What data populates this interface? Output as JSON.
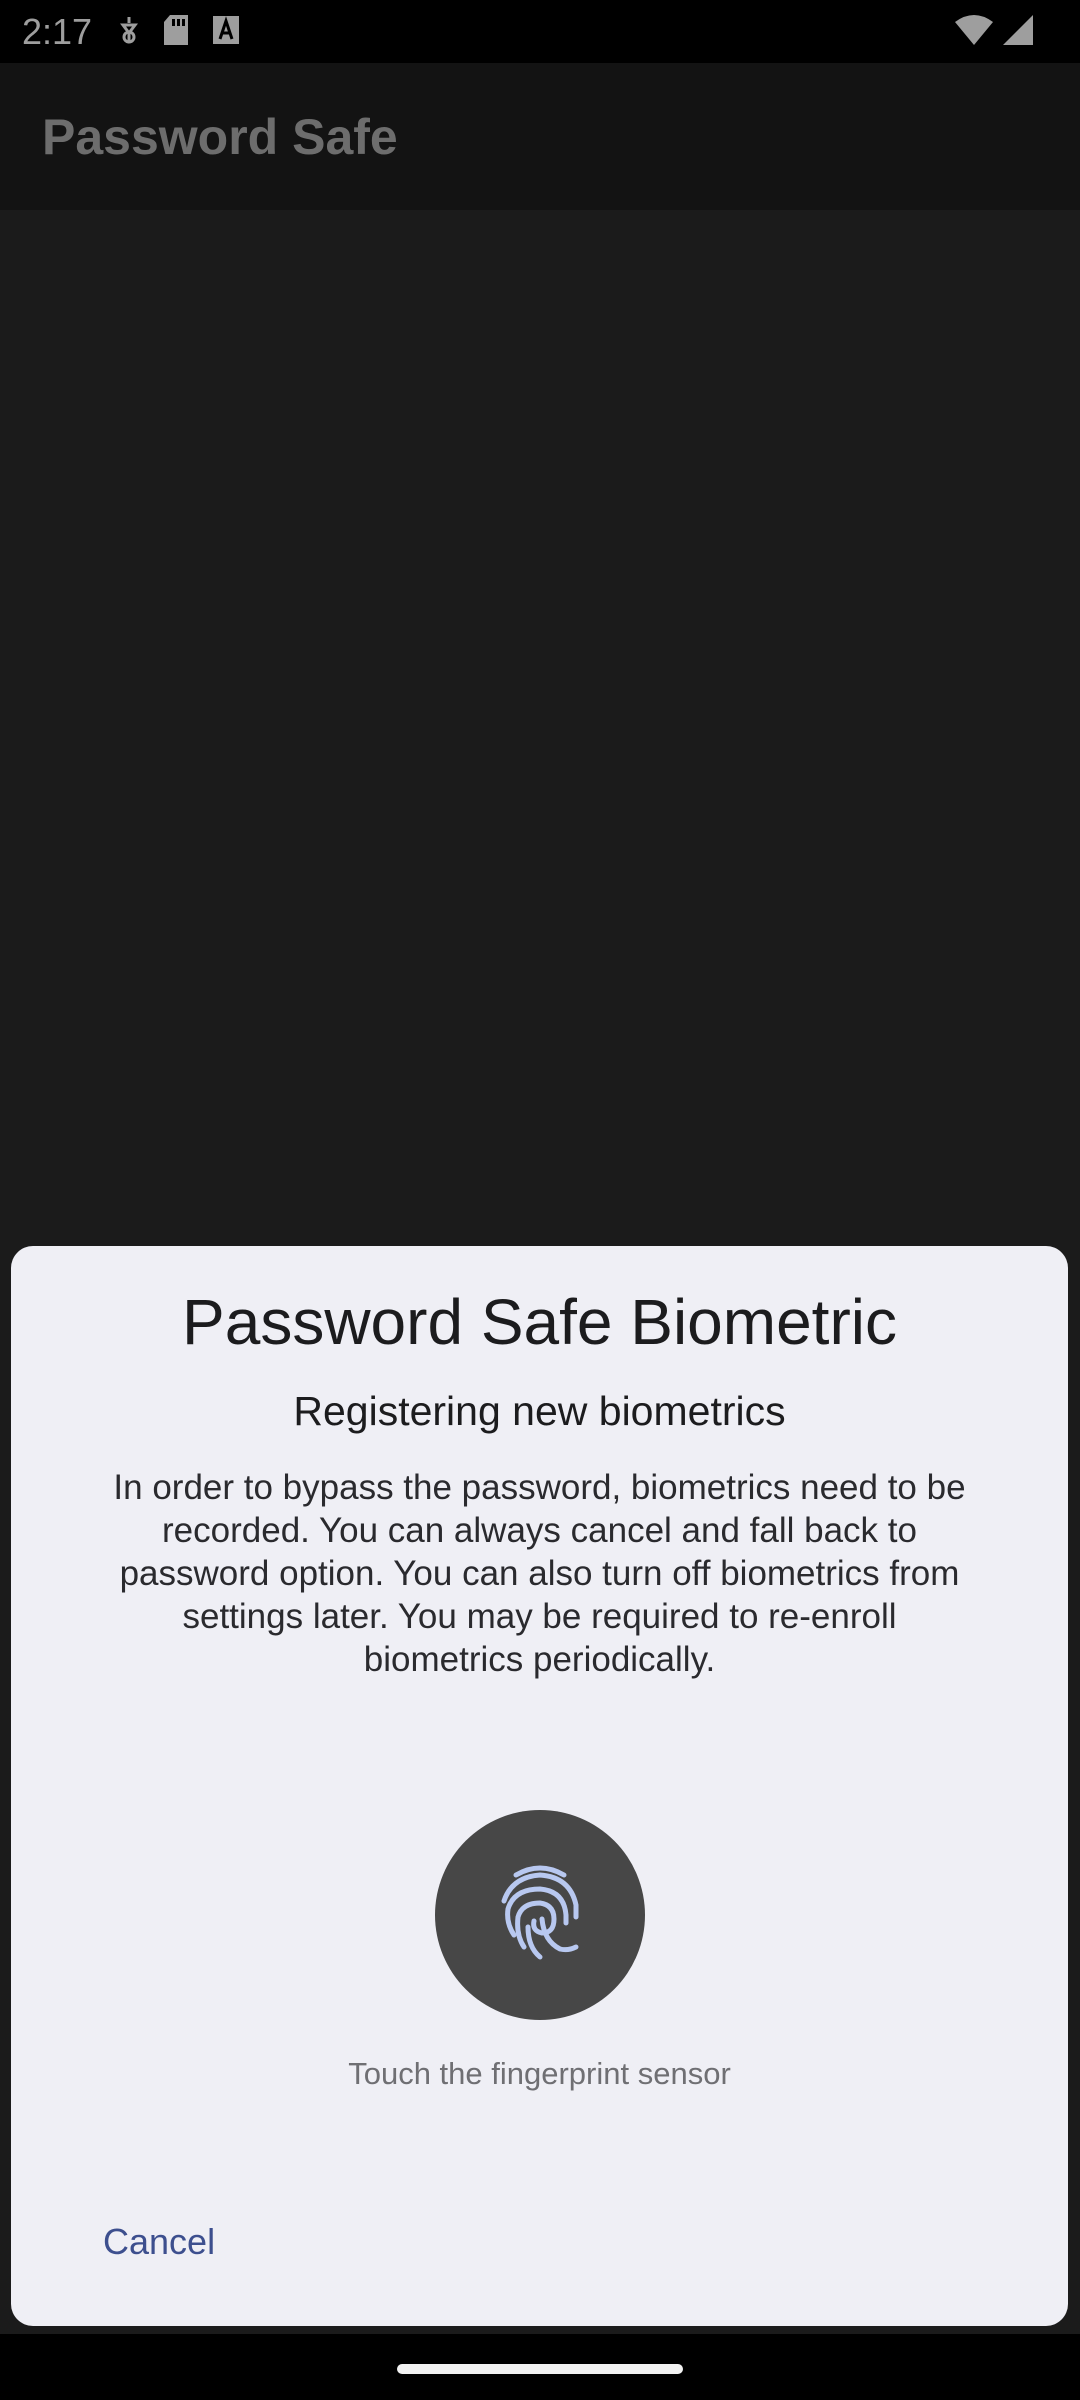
{
  "status_bar": {
    "time": "2:17",
    "left_icons": [
      "debug-icon",
      "sd-card-icon",
      "font-icon"
    ],
    "right_icons": [
      "wifi-icon",
      "signal-icon"
    ]
  },
  "app_bar": {
    "title": "Password Safe"
  },
  "dialog": {
    "title": "Password Safe Biometric",
    "subtitle": "Registering new biometrics",
    "description": "In order to bypass the password, biometrics need to be recorded. You can always cancel and fall back to password option. You can also turn off biometrics from settings later. You may be required to re-enroll biometrics periodically.",
    "fingerprint_icon": "fingerprint-icon",
    "hint": "Touch the fingerprint sensor",
    "cancel_label": "Cancel"
  },
  "colors": {
    "dialog_background": "#efeff5",
    "accent": "#3d4f8e",
    "fingerprint_circle": "#474747",
    "fingerprint_stroke": "#b8c8f0"
  }
}
